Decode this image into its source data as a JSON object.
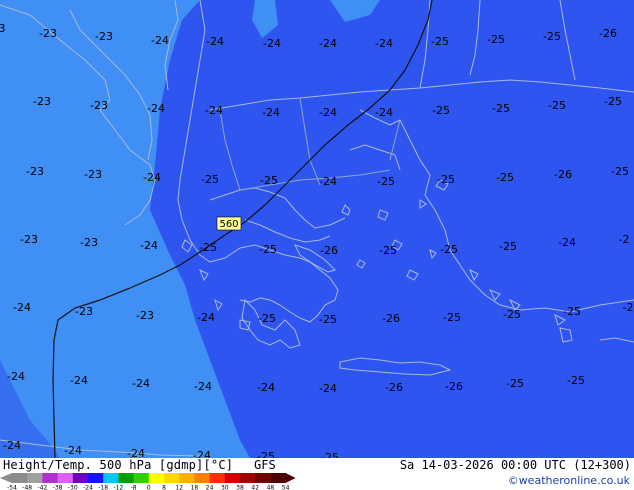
{
  "map": {
    "contour_label": "560",
    "temperature_labels": [
      "-23",
      "-23",
      "-24",
      "-24",
      "-24",
      "-24",
      "-24",
      "-25",
      "-25",
      "-25",
      "-26",
      "-23",
      "-23",
      "-24",
      "-24",
      "-24",
      "-24",
      "-24",
      "-25",
      "-25",
      "-25",
      "-25",
      "-23",
      "-23",
      "-24",
      "-25",
      "-25",
      "-24",
      "-25",
      "-25",
      "-25",
      "-26",
      "-25",
      "-23",
      "-23",
      "-24",
      "-25",
      "-25",
      "-26",
      "-25",
      "-25",
      "-25",
      "-24",
      "-2",
      "-24",
      "-23",
      "-23",
      "-24",
      "-25",
      "-25",
      "-26",
      "-25",
      "-25",
      "-25",
      "-2",
      "-24",
      "-24",
      "-24",
      "-24",
      "-24",
      "-24",
      "-26",
      "-26",
      "-25",
      "-25",
      "-24",
      "-24",
      "-24",
      "-24",
      "-25",
      "-25",
      "3"
    ]
  },
  "footer": {
    "title": "Height/Temp. 500 hPa [gdmp][°C]",
    "model": "GFS",
    "datetime": "Sa 14-03-2026 00:00 UTC (12+300)",
    "credit": "©weatheronline.co.uk"
  },
  "scale": {
    "ticks": [
      "-54",
      "-48",
      "-42",
      "-38",
      "-30",
      "-24",
      "-18",
      "-12",
      "-8",
      "0",
      "8",
      "12",
      "18",
      "24",
      "30",
      "38",
      "42",
      "48",
      "54"
    ],
    "colors": [
      "#8c8c8c",
      "#a0a0a0",
      "#b030d0",
      "#e060ff",
      "#7000c0",
      "#1414ff",
      "#00c8ff",
      "#00a000",
      "#30d000",
      "#ffff00",
      "#ffd800",
      "#ffb000",
      "#ff8000",
      "#ff3000",
      "#d00000",
      "#a00000",
      "#700000",
      "#500000"
    ]
  },
  "colors": {
    "sea_dark": "#2f55f0",
    "sea_light": "#3f8ff5",
    "coast": "#a9b9d6",
    "contour": "#111111"
  }
}
